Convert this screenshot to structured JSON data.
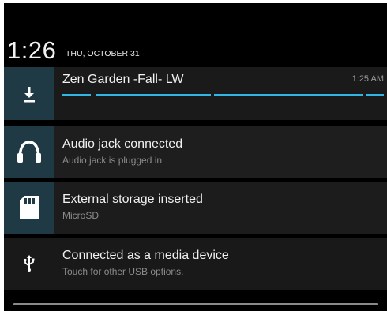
{
  "status_header": {
    "time": "1:26",
    "date": "THU, OCTOBER 31"
  },
  "notifications": [
    {
      "title": "Zen Garden -Fall- LW",
      "time": "1:25 AM",
      "icon": "download-icon",
      "progress_indeterminate": true
    },
    {
      "title": "Audio jack connected",
      "subtitle": "Audio jack is plugged in",
      "icon": "headphones-icon"
    },
    {
      "title": "External storage inserted",
      "subtitle": "MicroSD",
      "icon": "sd-card-icon"
    },
    {
      "title": "Connected as a media device",
      "subtitle": "Touch for other USB options.",
      "icon": "usb-icon"
    }
  ],
  "colors": {
    "accent": "#33b5e5",
    "icon_bg": "#1f3a44",
    "background": "#000000"
  }
}
